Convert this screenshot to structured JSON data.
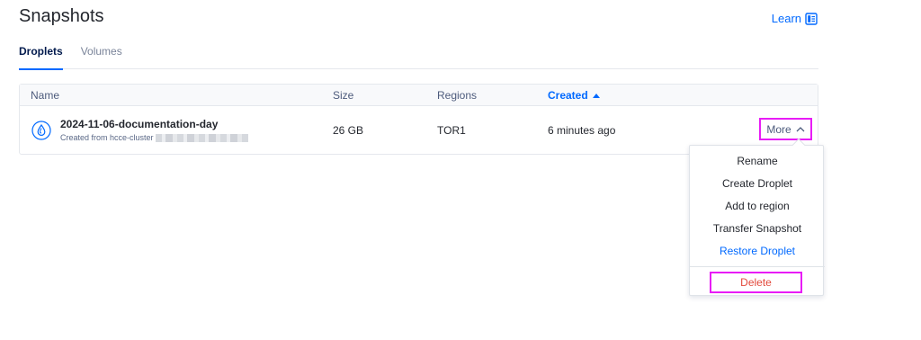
{
  "page": {
    "title": "Snapshots",
    "learn_label": "Learn"
  },
  "tabs": [
    {
      "label": "Droplets",
      "active": true
    },
    {
      "label": "Volumes",
      "active": false
    }
  ],
  "table": {
    "columns": {
      "name": "Name",
      "size": "Size",
      "regions": "Regions",
      "created": "Created"
    },
    "sort": {
      "column": "Created",
      "direction": "ascending"
    },
    "rows": [
      {
        "name": "2024-11-06-documentation-day",
        "subtitle": "Created from hcce-cluster",
        "size": "26 GB",
        "region": "TOR1",
        "created": "6 minutes ago",
        "action_label": "More"
      }
    ]
  },
  "menu": {
    "items": [
      {
        "label": "Rename"
      },
      {
        "label": "Create Droplet"
      },
      {
        "label": "Add to region"
      },
      {
        "label": "Transfer Snapshot"
      },
      {
        "label": "Restore Droplet"
      }
    ],
    "delete_label": "Delete"
  },
  "colors": {
    "accent": "#0069ff",
    "highlight": "#e81cf6",
    "danger": "#e24a3c"
  },
  "icons": {
    "learn": "book-icon",
    "snapshot": "droplet-icon",
    "sort": "caret-up-icon",
    "more": "chevron-up-icon"
  }
}
